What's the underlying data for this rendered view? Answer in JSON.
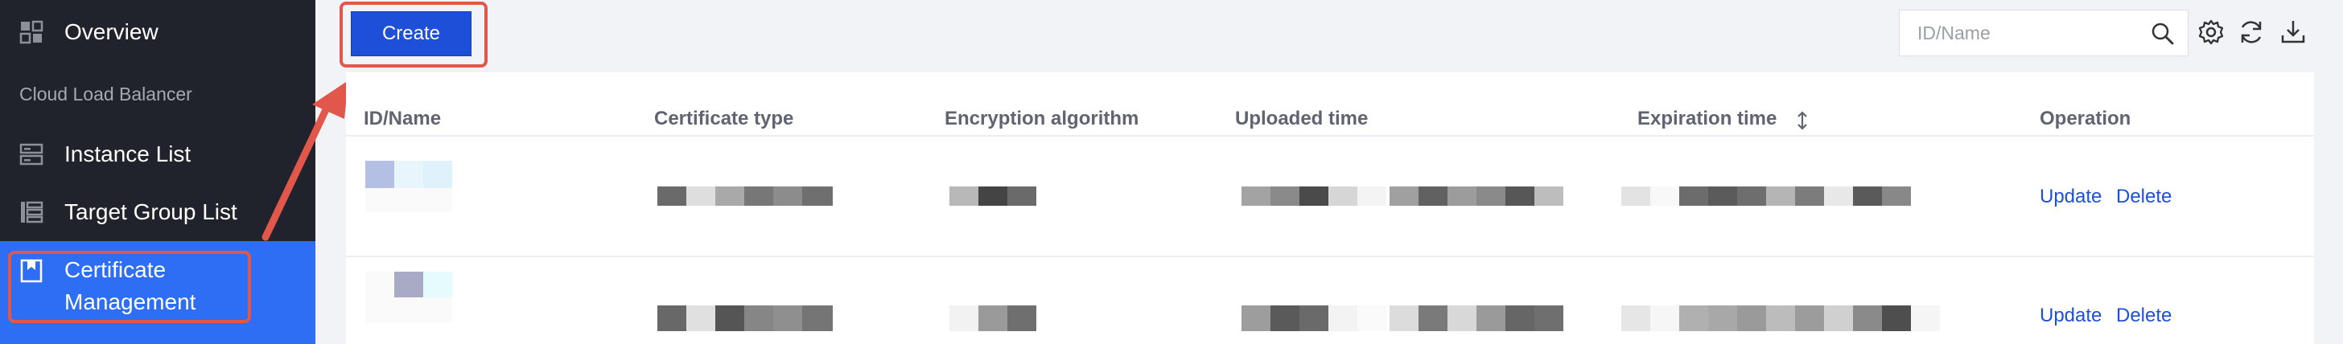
{
  "sidebar": {
    "items": [
      {
        "label": "Overview",
        "icon": "grid-icon"
      },
      {
        "label": "Instance List",
        "icon": "server-icon"
      },
      {
        "label": "Target Group List",
        "icon": "list-icon"
      }
    ],
    "section_label": "Cloud Load Balancer",
    "active_item": {
      "line1": "Certificate",
      "line2": "Management",
      "icon": "certificate-icon"
    }
  },
  "toolbar": {
    "create_label": "Create",
    "search_placeholder": "ID/Name",
    "icons": [
      "search-icon",
      "gear-icon",
      "refresh-icon",
      "download-icon"
    ]
  },
  "table": {
    "columns": [
      "ID/Name",
      "Certificate type",
      "Encryption algorithm",
      "Uploaded time",
      "Expiration time",
      "Operation"
    ],
    "sort_icon": "sort-icon",
    "rows": [
      {
        "actions": {
          "update": "Update",
          "delete": "Delete"
        }
      },
      {
        "actions": {
          "update": "Update",
          "delete": "Delete"
        }
      }
    ]
  },
  "colors": {
    "accent": "#1d4fd8",
    "sidebar_bg": "#20232b",
    "active_bg": "#2d6ef5",
    "highlight": "#e2574c"
  }
}
